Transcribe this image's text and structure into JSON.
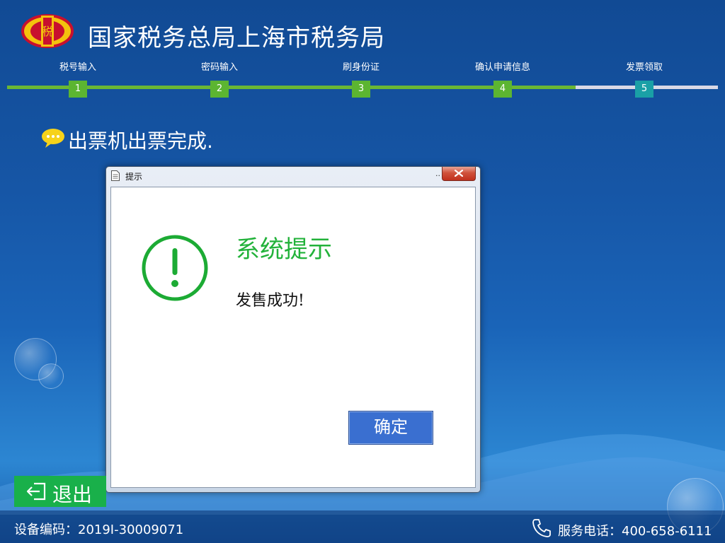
{
  "header": {
    "title": "国家税务总局上海市税务局",
    "emblem_icon": "tax-emblem-icon"
  },
  "steps": [
    {
      "label": "税号输入",
      "number": "1",
      "state": "done"
    },
    {
      "label": "密码输入",
      "number": "2",
      "state": "done"
    },
    {
      "label": "刷身份证",
      "number": "3",
      "state": "done"
    },
    {
      "label": "确认申请信息",
      "number": "4",
      "state": "done"
    },
    {
      "label": "发票领取",
      "number": "5",
      "state": "current"
    }
  ],
  "message": {
    "text": "出票机出票完成.",
    "icon": "chat-bubble-icon"
  },
  "dialog": {
    "title": "提示",
    "title_dots": "..",
    "heading": "系统提示",
    "message": "发售成功!",
    "ok_label": "确定",
    "icon": "alert-circle-icon"
  },
  "exit": {
    "label": "退出",
    "icon": "exit-icon"
  },
  "footer": {
    "device_code": "设备编码：2019I-30009071",
    "service_phone": "服务电话：400-658-6111"
  },
  "colors": {
    "step_done": "#5cb531",
    "step_current": "#1aa0a6",
    "heading_green": "#22b23a",
    "ok_button": "#3a6fd0",
    "exit_button": "#19b04a"
  }
}
